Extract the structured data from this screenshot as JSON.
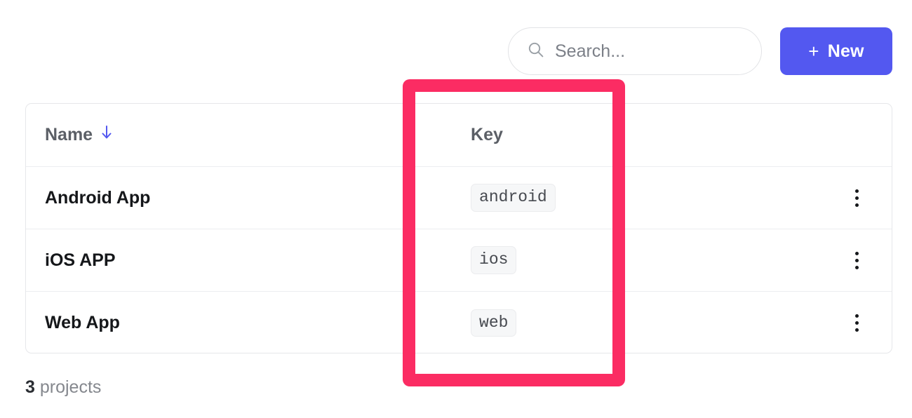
{
  "toolbar": {
    "search": {
      "placeholder": "Search...",
      "value": "",
      "icon": "search-icon"
    },
    "new_button": {
      "plus": "+",
      "label": "New"
    }
  },
  "table": {
    "columns": [
      {
        "key": "name",
        "label": "Name",
        "sorted": true,
        "sort_direction": "desc",
        "sort_icon": "arrow-down-icon"
      },
      {
        "key": "key",
        "label": "Key",
        "sorted": false
      },
      {
        "key": "actions",
        "label": ""
      }
    ],
    "rows": [
      {
        "name": "Android App",
        "key": "android",
        "menu_icon": "more-vertical-icon"
      },
      {
        "name": "iOS APP",
        "key": "ios",
        "menu_icon": "more-vertical-icon"
      },
      {
        "name": "Web App",
        "key": "web",
        "menu_icon": "more-vertical-icon"
      }
    ]
  },
  "footer": {
    "count": "3",
    "label": "projects"
  },
  "annotation": {
    "type": "highlight-rectangle",
    "target_column": "Key",
    "color": "#fb2c63"
  },
  "colors": {
    "accent": "#5358f0",
    "sort_arrow": "#5358f0",
    "highlight": "#fb2c63",
    "badge_bg": "#f6f7f8",
    "border": "#e6e7ea",
    "text_primary": "#15171a",
    "text_muted": "#85888e"
  }
}
